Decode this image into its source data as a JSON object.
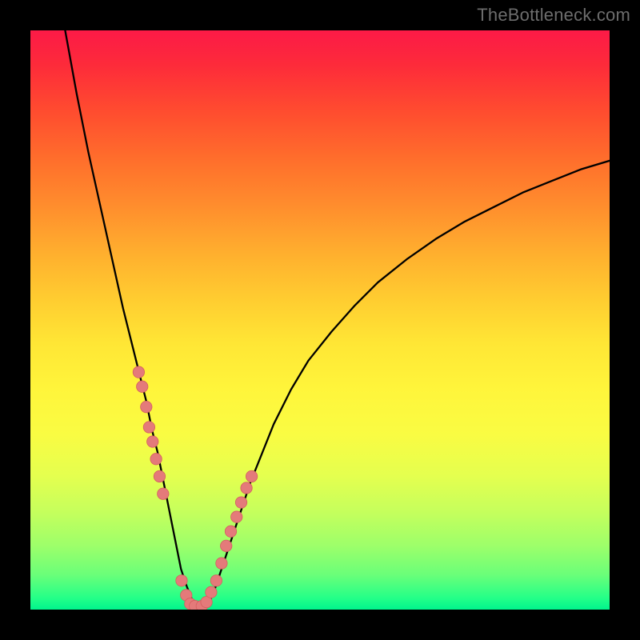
{
  "watermark": "TheBottleneck.com",
  "colors": {
    "bg": "#000000",
    "curve": "#000000",
    "marker_fill": "#e47a7a",
    "marker_stroke": "#d45f5f",
    "gradient_top": "#fc1a47",
    "gradient_bottom": "#00f48d"
  },
  "chart_data": {
    "type": "line",
    "title": "",
    "xlabel": "",
    "ylabel": "",
    "xlim": [
      0,
      100
    ],
    "ylim": [
      0,
      100
    ],
    "grid": false,
    "legend": false,
    "series": [
      {
        "name": "curve",
        "x": [
          6,
          8,
          10,
          12,
          14,
          16,
          18,
          20,
          21,
          22,
          23,
          24,
          25,
          26,
          27,
          28,
          29,
          30,
          31,
          32,
          34,
          36,
          38,
          40,
          42,
          45,
          48,
          52,
          56,
          60,
          65,
          70,
          75,
          80,
          85,
          90,
          95,
          100
        ],
        "y": [
          100,
          89,
          79,
          70,
          61,
          52,
          44,
          36,
          31,
          27,
          22,
          17,
          12,
          7,
          4,
          1.5,
          0.5,
          0.5,
          1.5,
          4,
          10,
          16,
          22,
          27,
          32,
          38,
          43,
          48,
          52.5,
          56.5,
          60.5,
          64,
          67,
          69.5,
          72,
          74,
          76,
          77.5
        ]
      }
    ],
    "markers": {
      "name": "points",
      "x": [
        18.7,
        19.3,
        20.0,
        20.5,
        21.1,
        21.7,
        22.3,
        22.9,
        26.1,
        26.9,
        27.6,
        28.4,
        29.6,
        30.4,
        31.2,
        32.1,
        33.0,
        33.8,
        34.6,
        35.6,
        36.4,
        37.3,
        38.2
      ],
      "y": [
        41.0,
        38.5,
        35.0,
        31.5,
        29.0,
        26.0,
        23.0,
        20.0,
        5.0,
        2.5,
        1.0,
        0.6,
        0.6,
        1.3,
        3.0,
        5.0,
        8.0,
        11.0,
        13.5,
        16.0,
        18.5,
        21.0,
        23.0
      ]
    }
  }
}
